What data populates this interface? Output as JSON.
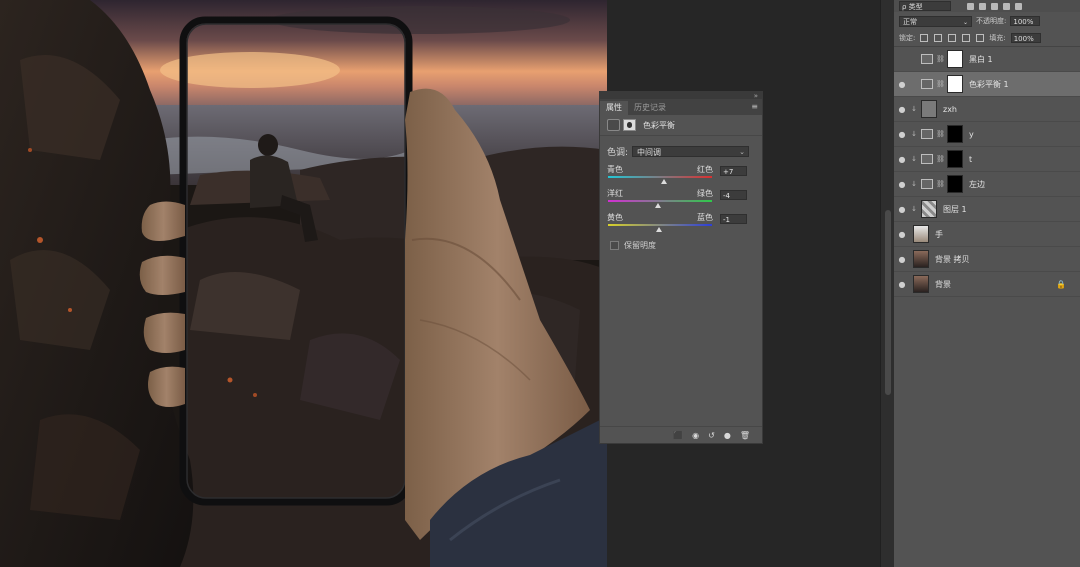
{
  "properties_panel": {
    "collapse_glyph": "»",
    "menu_glyph": "≡",
    "tabs": [
      {
        "label": "属性",
        "active": true
      },
      {
        "label": "历史记录",
        "active": false
      }
    ],
    "adjustment_title": "色彩平衡",
    "tone": {
      "label": "色调:",
      "value": "中间调"
    },
    "sliders": [
      {
        "left_label": "青色",
        "right_label": "红色",
        "value": "+7",
        "numeric": 7,
        "gradient": [
          "#22c7d6",
          "#d93030"
        ]
      },
      {
        "left_label": "洋红",
        "right_label": "绿色",
        "value": "-4",
        "numeric": -4,
        "gradient": [
          "#d22fd2",
          "#2fc94a"
        ]
      },
      {
        "left_label": "黄色",
        "right_label": "蓝色",
        "value": "-1",
        "numeric": -1,
        "gradient": [
          "#d8d12a",
          "#2d3fd8"
        ]
      }
    ],
    "preserve_luminosity": {
      "label": "保留明度",
      "checked": false
    },
    "footer_icons": [
      "clip-to-layer-icon",
      "view-previous-icon",
      "reset-icon",
      "visibility-icon",
      "delete-icon"
    ],
    "footer_glyphs": [
      "⬛",
      "◉",
      "↺",
      "●",
      "🗑"
    ]
  },
  "layers_panel": {
    "filter": {
      "value": "ρ 类型"
    },
    "blend_mode": "正常",
    "opacity": {
      "label": "不透明度:",
      "value": "100%"
    },
    "lock_label": "锁定:",
    "fill": {
      "label": "填充:",
      "value": "100%"
    },
    "eye_glyph": "●",
    "lock_glyph": "🔒",
    "layers": [
      {
        "name": "黑白 1",
        "visible": false,
        "kind": "adjustment",
        "selected": false
      },
      {
        "name": "色彩平衡 1",
        "visible": true,
        "kind": "adjustment",
        "selected": true
      },
      {
        "name": "zxh",
        "visible": true,
        "kind": "clipped-pixel",
        "selected": false
      },
      {
        "name": "y",
        "visible": true,
        "kind": "adjustment-mask",
        "selected": false
      },
      {
        "name": "t",
        "visible": true,
        "kind": "adjustment-mask",
        "selected": false
      },
      {
        "name": "左边",
        "visible": true,
        "kind": "adjustment-mask",
        "selected": false
      },
      {
        "name": "图层 1",
        "visible": true,
        "kind": "clipped-pixel",
        "selected": false
      },
      {
        "name": "手",
        "visible": true,
        "kind": "pixel",
        "selected": false
      },
      {
        "name": "背景 拷贝",
        "visible": true,
        "kind": "pixel",
        "selected": false
      },
      {
        "name": "背景",
        "visible": true,
        "kind": "pixel",
        "selected": false,
        "locked": true
      }
    ]
  },
  "colors": {
    "panel_bg": "#535353",
    "selected_layer": "#6d6d6d",
    "workspace_bg": "#262626"
  }
}
